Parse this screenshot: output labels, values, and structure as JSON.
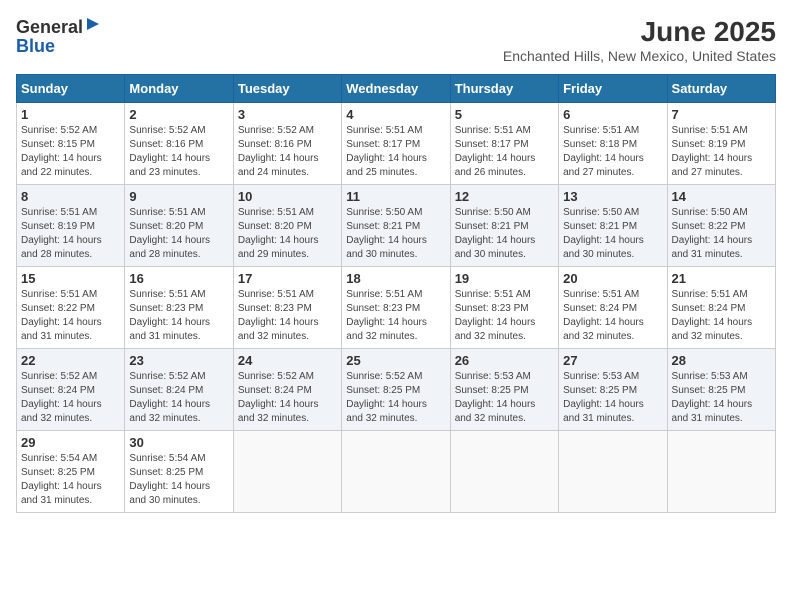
{
  "logo": {
    "general": "General",
    "blue": "Blue"
  },
  "title": "June 2025",
  "location": "Enchanted Hills, New Mexico, United States",
  "days_of_week": [
    "Sunday",
    "Monday",
    "Tuesday",
    "Wednesday",
    "Thursday",
    "Friday",
    "Saturday"
  ],
  "weeks": [
    [
      {
        "day": "1",
        "sunrise": "5:52 AM",
        "sunset": "8:15 PM",
        "daylight": "14 hours and 22 minutes."
      },
      {
        "day": "2",
        "sunrise": "5:52 AM",
        "sunset": "8:16 PM",
        "daylight": "14 hours and 23 minutes."
      },
      {
        "day": "3",
        "sunrise": "5:52 AM",
        "sunset": "8:16 PM",
        "daylight": "14 hours and 24 minutes."
      },
      {
        "day": "4",
        "sunrise": "5:51 AM",
        "sunset": "8:17 PM",
        "daylight": "14 hours and 25 minutes."
      },
      {
        "day": "5",
        "sunrise": "5:51 AM",
        "sunset": "8:17 PM",
        "daylight": "14 hours and 26 minutes."
      },
      {
        "day": "6",
        "sunrise": "5:51 AM",
        "sunset": "8:18 PM",
        "daylight": "14 hours and 27 minutes."
      },
      {
        "day": "7",
        "sunrise": "5:51 AM",
        "sunset": "8:19 PM",
        "daylight": "14 hours and 27 minutes."
      }
    ],
    [
      {
        "day": "8",
        "sunrise": "5:51 AM",
        "sunset": "8:19 PM",
        "daylight": "14 hours and 28 minutes."
      },
      {
        "day": "9",
        "sunrise": "5:51 AM",
        "sunset": "8:20 PM",
        "daylight": "14 hours and 28 minutes."
      },
      {
        "day": "10",
        "sunrise": "5:51 AM",
        "sunset": "8:20 PM",
        "daylight": "14 hours and 29 minutes."
      },
      {
        "day": "11",
        "sunrise": "5:50 AM",
        "sunset": "8:21 PM",
        "daylight": "14 hours and 30 minutes."
      },
      {
        "day": "12",
        "sunrise": "5:50 AM",
        "sunset": "8:21 PM",
        "daylight": "14 hours and 30 minutes."
      },
      {
        "day": "13",
        "sunrise": "5:50 AM",
        "sunset": "8:21 PM",
        "daylight": "14 hours and 30 minutes."
      },
      {
        "day": "14",
        "sunrise": "5:50 AM",
        "sunset": "8:22 PM",
        "daylight": "14 hours and 31 minutes."
      }
    ],
    [
      {
        "day": "15",
        "sunrise": "5:51 AM",
        "sunset": "8:22 PM",
        "daylight": "14 hours and 31 minutes."
      },
      {
        "day": "16",
        "sunrise": "5:51 AM",
        "sunset": "8:23 PM",
        "daylight": "14 hours and 31 minutes."
      },
      {
        "day": "17",
        "sunrise": "5:51 AM",
        "sunset": "8:23 PM",
        "daylight": "14 hours and 32 minutes."
      },
      {
        "day": "18",
        "sunrise": "5:51 AM",
        "sunset": "8:23 PM",
        "daylight": "14 hours and 32 minutes."
      },
      {
        "day": "19",
        "sunrise": "5:51 AM",
        "sunset": "8:23 PM",
        "daylight": "14 hours and 32 minutes."
      },
      {
        "day": "20",
        "sunrise": "5:51 AM",
        "sunset": "8:24 PM",
        "daylight": "14 hours and 32 minutes."
      },
      {
        "day": "21",
        "sunrise": "5:51 AM",
        "sunset": "8:24 PM",
        "daylight": "14 hours and 32 minutes."
      }
    ],
    [
      {
        "day": "22",
        "sunrise": "5:52 AM",
        "sunset": "8:24 PM",
        "daylight": "14 hours and 32 minutes."
      },
      {
        "day": "23",
        "sunrise": "5:52 AM",
        "sunset": "8:24 PM",
        "daylight": "14 hours and 32 minutes."
      },
      {
        "day": "24",
        "sunrise": "5:52 AM",
        "sunset": "8:24 PM",
        "daylight": "14 hours and 32 minutes."
      },
      {
        "day": "25",
        "sunrise": "5:52 AM",
        "sunset": "8:25 PM",
        "daylight": "14 hours and 32 minutes."
      },
      {
        "day": "26",
        "sunrise": "5:53 AM",
        "sunset": "8:25 PM",
        "daylight": "14 hours and 32 minutes."
      },
      {
        "day": "27",
        "sunrise": "5:53 AM",
        "sunset": "8:25 PM",
        "daylight": "14 hours and 31 minutes."
      },
      {
        "day": "28",
        "sunrise": "5:53 AM",
        "sunset": "8:25 PM",
        "daylight": "14 hours and 31 minutes."
      }
    ],
    [
      {
        "day": "29",
        "sunrise": "5:54 AM",
        "sunset": "8:25 PM",
        "daylight": "14 hours and 31 minutes."
      },
      {
        "day": "30",
        "sunrise": "5:54 AM",
        "sunset": "8:25 PM",
        "daylight": "14 hours and 30 minutes."
      },
      null,
      null,
      null,
      null,
      null
    ]
  ],
  "labels": {
    "sunrise": "Sunrise:",
    "sunset": "Sunset:",
    "daylight": "Daylight:"
  }
}
